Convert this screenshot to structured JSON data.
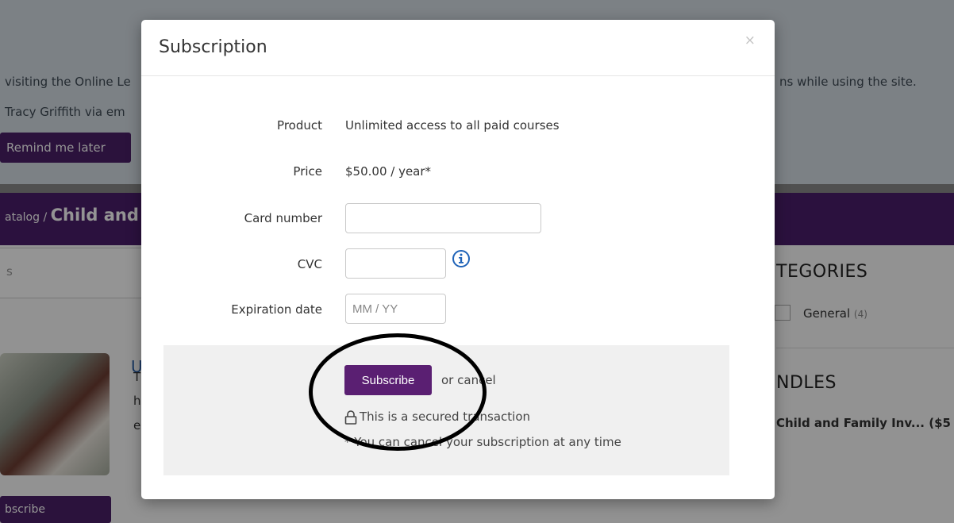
{
  "background": {
    "banner_line1_left": "visiting the Online Le",
    "banner_line1_right": "ns while using the site.",
    "banner_line2": "Tracy Griffith via em",
    "remind_button": "Remind me later",
    "breadcrumb_prefix": "atalog /",
    "breadcrumb_title": "Child and",
    "search_placeholder": "s",
    "categories_heading": "TEGORIES",
    "category_item": "General",
    "category_count": "(4)",
    "bundles_heading": "NDLES",
    "bundle_item": "Child and Family Inv... ($5",
    "course_letter": "U",
    "course_desc_letters": [
      "T",
      "h",
      "e"
    ],
    "subscribe_button": "bscribe"
  },
  "modal": {
    "title": "Subscription",
    "close_symbol": "×",
    "product_label": "Product",
    "product_value": "Unlimited access to all paid courses",
    "price_label": "Price",
    "price_value": "$50.00 / year*",
    "card_label": "Card number",
    "card_value": "",
    "cvc_label": "CVC",
    "cvc_value": "",
    "expiration_label": "Expiration date",
    "expiration_placeholder": "MM / YY",
    "subscribe_label": "Subscribe",
    "or_text": "or",
    "cancel_label": "cancel",
    "secured_text": "This is a secured transaction",
    "note_text": "* You can cancel your subscription at any time"
  },
  "icons": {
    "info": "info-icon",
    "lock": "lock-icon",
    "close": "close-icon"
  },
  "colors": {
    "brand_purple": "#4b1e6b",
    "button_purple": "#5a1f72",
    "info_blue": "#1f63b8",
    "annotation": "#000000"
  }
}
